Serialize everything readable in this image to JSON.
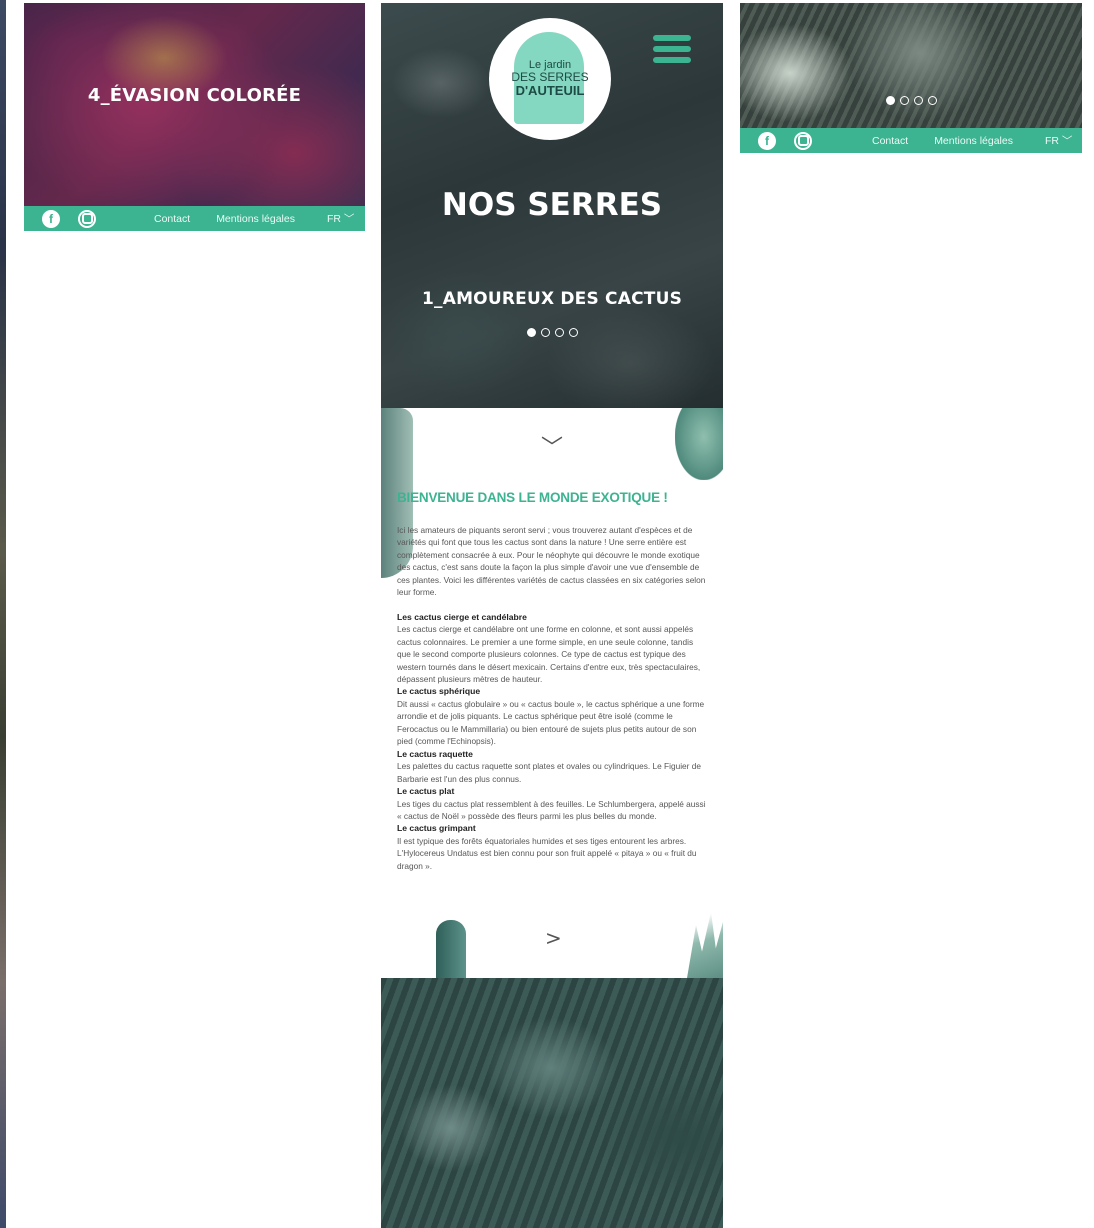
{
  "slides": {
    "left_title": "4_ÉVASION COLORÉE",
    "center_title": "1_AMOUREUX DES CACTUS"
  },
  "logo": {
    "line1": "Le jardin",
    "line2": "DES SERRES",
    "line3": "D'AUTEUIL"
  },
  "hero": {
    "title": "NOS SERRES"
  },
  "footer": {
    "contact": "Contact",
    "legal": "Mentions légales",
    "lang": "FR ﹀",
    "facebook": "f"
  },
  "content": {
    "chevron_down": "﹀",
    "chevron_next": ">",
    "heading": "BIENVENUE DANS LE MONDE EXOTIQUE !",
    "intro": "Ici les amateurs de piquants seront servi ; vous trouverez autant d'espèces et de variétés qui font que tous les cactus sont dans la nature ! Une serre entière est complètement consacrée à eux. Pour le néophyte qui découvre le monde exotique des cactus, c'est sans doute la façon la plus simple d'avoir une vue d'ensemble de ces plantes. Voici les différentes variétés de cactus classées en six catégories selon leur forme.",
    "sections": [
      {
        "title": "Les cactus cierge et candélabre",
        "text": "Les cactus cierge et candélabre ont une forme en colonne, et sont aussi appelés cactus colonnaires. Le premier a une forme simple, en une seule colonne, tandis que le second comporte plusieurs colonnes. Ce type de cactus est typique des western tournés dans le désert mexicain. Certains d'entre eux, très spectaculaires, dépassent plusieurs mètres de hauteur."
      },
      {
        "title": "Le cactus sphérique",
        "text": "Dit aussi « cactus globulaire » ou « cactus boule », le cactus sphérique a une forme arrondie et de jolis piquants. Le cactus sphérique peut être isolé (comme le Ferocactus ou le Mammillaria) ou bien entouré de sujets plus petits autour de son pied (comme l'Echinopsis)."
      },
      {
        "title": "Le cactus raquette",
        "text": "Les palettes du cactus raquette sont plates et ovales ou cylindriques. Le Figuier de Barbarie est l'un des plus connus."
      },
      {
        "title": "Le cactus plat",
        "text": "Les tiges du cactus plat ressemblent à des feuilles. Le Schlumbergera, appelé aussi « cactus de Noël » possède des fleurs parmi les plus belles du monde."
      },
      {
        "title": "Le cactus grimpant",
        "text": "Il est typique des forêts équatoriales humides et ses tiges entourent les arbres. L'Hylocereus Undatus est bien connu pour son fruit appelé « pitaya » ou « fruit du dragon »."
      }
    ]
  },
  "carousel": {
    "count": 4,
    "active_index": 0
  },
  "colors": {
    "accent": "#3cb391",
    "text": "#575757"
  },
  "icons": [
    "facebook-icon",
    "instagram-icon",
    "hamburger-menu-icon",
    "chevron-down-icon",
    "chevron-right-icon"
  ]
}
